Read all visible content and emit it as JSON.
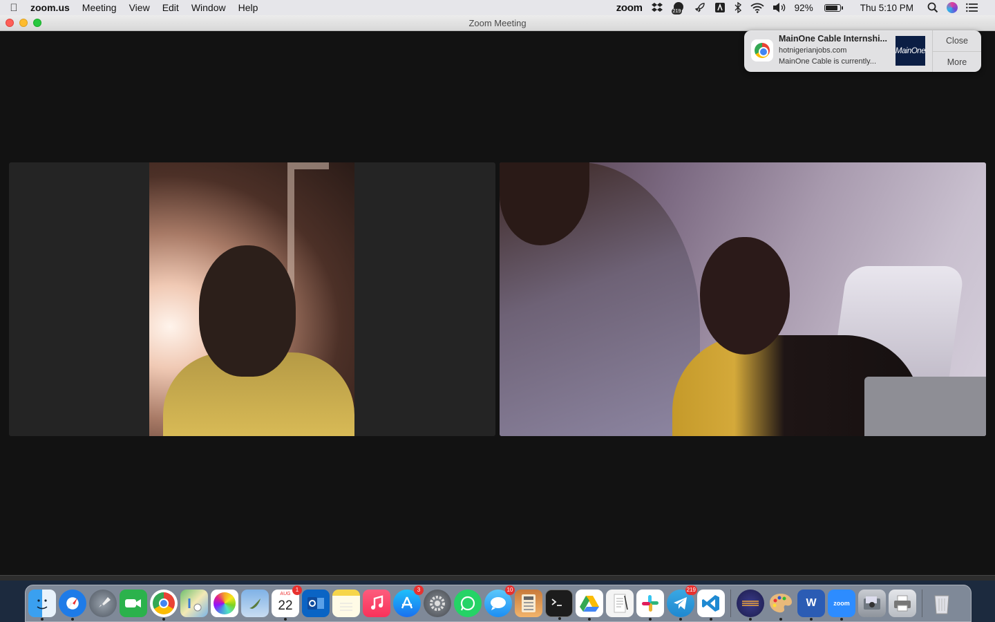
{
  "menubar": {
    "app_name": "zoom.us",
    "menus": [
      "Meeting",
      "View",
      "Edit",
      "Window",
      "Help"
    ],
    "status": {
      "zoom_label": "zoom",
      "notification_count": "219",
      "battery_percent": "92%",
      "battery_level": 0.92,
      "clock": "Thu 5:10 PM"
    }
  },
  "window": {
    "title": "Zoom Meeting"
  },
  "notification": {
    "title": "MainOne Cable Internshi...",
    "source": "hotnigerianjobs.com",
    "body": "MainOne Cable is currently...",
    "thumb_text": "MainOne",
    "close_label": "Close",
    "more_label": "More"
  },
  "dock": {
    "calendar_month": "AUG",
    "calendar_day": "22",
    "calendar_badge": "1",
    "appstore_badge": "3",
    "messages_badge": "10",
    "telegram_badge": "219",
    "zoom_label": "zoom",
    "word_label": "W"
  },
  "colors": {
    "window_bg": "#121212",
    "tile_bg": "#242424",
    "dock_badge": "#e8312f",
    "traffic_close": "#fe5f57",
    "traffic_min": "#febc2e",
    "traffic_max": "#28c840"
  }
}
